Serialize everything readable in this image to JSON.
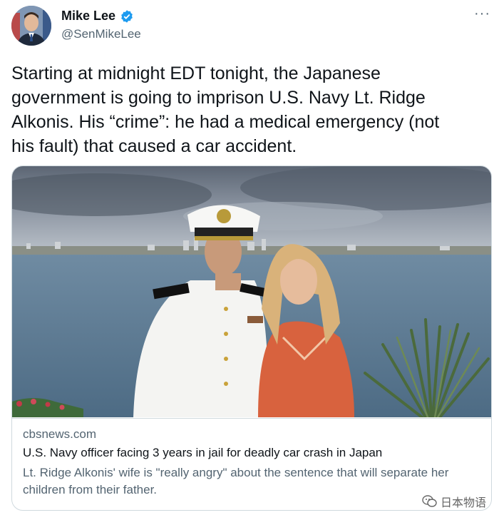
{
  "author": {
    "display_name": "Mike Lee",
    "handle": "@SenMikeLee",
    "verified_icon": "verified-badge-icon",
    "avatar_icon": "profile-photo"
  },
  "more_label": "···",
  "tweet": {
    "text": "Starting at midnight EDT tonight, the Japanese\ngovernment is going to imprison U.S. Navy Lt. Ridge\nAlkonis.  His “crime”: he had a medical emergency (not\nhis fault) that caused a car accident."
  },
  "card": {
    "image_icon": "news-photo-navy-officer-and-wife",
    "domain": "cbsnews.com",
    "title": "U.S. Navy officer facing 3 years in jail for deadly car crash in Japan",
    "description": "Lt. Ridge Alkonis' wife is \"really angry\" about the sentence that will separate her children from their father."
  },
  "watermark": {
    "text": "日本物语",
    "icon": "wechat-icon"
  },
  "colors": {
    "verified": "#1d9bf0",
    "secondary_text": "#536471",
    "border": "#cfd9de"
  }
}
